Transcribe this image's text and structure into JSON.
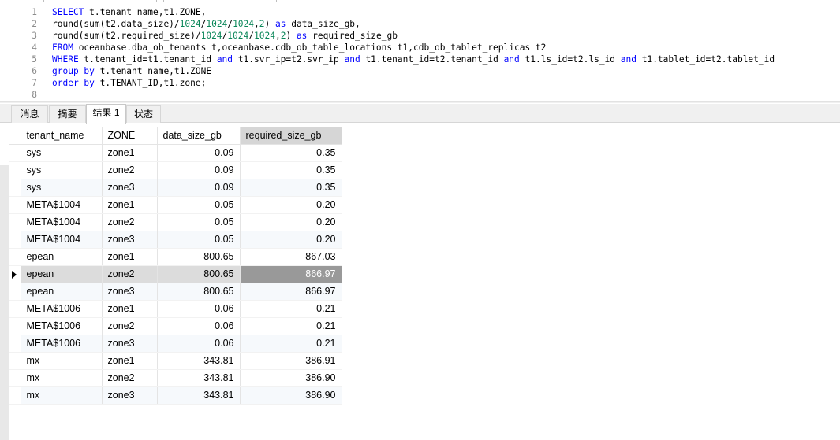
{
  "editor": {
    "lines": [
      {
        "n": "1",
        "parts": [
          [
            "kw",
            "SELECT"
          ],
          [
            "t",
            " t.tenant_name,t1.ZONE,"
          ]
        ]
      },
      {
        "n": "2",
        "parts": [
          [
            "t",
            "round(sum(t2.data_size)/"
          ],
          [
            "num",
            "1024"
          ],
          [
            "t",
            "/"
          ],
          [
            "num",
            "1024"
          ],
          [
            "t",
            "/"
          ],
          [
            "num",
            "1024"
          ],
          [
            "t",
            ","
          ],
          [
            "num",
            "2"
          ],
          [
            "t",
            ") "
          ],
          [
            "kw",
            "as"
          ],
          [
            "t",
            " data_size_gb,"
          ]
        ]
      },
      {
        "n": "3",
        "parts": [
          [
            "t",
            "round(sum(t2.required_size)/"
          ],
          [
            "num",
            "1024"
          ],
          [
            "t",
            "/"
          ],
          [
            "num",
            "1024"
          ],
          [
            "t",
            "/"
          ],
          [
            "num",
            "1024"
          ],
          [
            "t",
            ","
          ],
          [
            "num",
            "2"
          ],
          [
            "t",
            ") "
          ],
          [
            "kw",
            "as"
          ],
          [
            "t",
            " required_size_gb"
          ]
        ]
      },
      {
        "n": "4",
        "parts": [
          [
            "kw",
            "FROM"
          ],
          [
            "t",
            " oceanbase.dba_ob_tenants t,oceanbase.cdb_ob_table_locations t1,cdb_ob_tablet_replicas t2"
          ]
        ]
      },
      {
        "n": "5",
        "parts": [
          [
            "kw",
            "WHERE"
          ],
          [
            "t",
            " t.tenant_id=t1.tenant_id "
          ],
          [
            "kw",
            "and"
          ],
          [
            "t",
            " t1.svr_ip=t2.svr_ip "
          ],
          [
            "kw",
            "and"
          ],
          [
            "t",
            " t1.tenant_id=t2.tenant_id "
          ],
          [
            "kw",
            "and"
          ],
          [
            "t",
            " t1.ls_id=t2.ls_id "
          ],
          [
            "kw",
            "and"
          ],
          [
            "t",
            " t1.tablet_id=t2.tablet_id"
          ]
        ]
      },
      {
        "n": "6",
        "parts": [
          [
            "kw",
            "group by"
          ],
          [
            "t",
            " t.tenant_name,t1.ZONE"
          ]
        ]
      },
      {
        "n": "7",
        "parts": [
          [
            "kw",
            "order by"
          ],
          [
            "t",
            " t.TENANT_ID,t1.zone;"
          ]
        ]
      },
      {
        "n": "8",
        "parts": []
      }
    ]
  },
  "tabs": [
    {
      "label": "消息",
      "active": false
    },
    {
      "label": "摘要",
      "active": false
    },
    {
      "label": "结果 1",
      "active": true
    },
    {
      "label": "状态",
      "active": false
    }
  ],
  "grid": {
    "columns": [
      "tenant_name",
      "ZONE",
      "data_size_gb",
      "required_size_gb"
    ],
    "sorted_column": 3,
    "selected_row": 7,
    "rows": [
      [
        "sys",
        "zone1",
        "0.09",
        "0.35"
      ],
      [
        "sys",
        "zone2",
        "0.09",
        "0.35"
      ],
      [
        "sys",
        "zone3",
        "0.09",
        "0.35"
      ],
      [
        "META$1004",
        "zone1",
        "0.05",
        "0.20"
      ],
      [
        "META$1004",
        "zone2",
        "0.05",
        "0.20"
      ],
      [
        "META$1004",
        "zone3",
        "0.05",
        "0.20"
      ],
      [
        "epean",
        "zone1",
        "800.65",
        "867.03"
      ],
      [
        "epean",
        "zone2",
        "800.65",
        "866.97"
      ],
      [
        "epean",
        "zone3",
        "800.65",
        "866.97"
      ],
      [
        "META$1006",
        "zone1",
        "0.06",
        "0.21"
      ],
      [
        "META$1006",
        "zone2",
        "0.06",
        "0.21"
      ],
      [
        "META$1006",
        "zone3",
        "0.06",
        "0.21"
      ],
      [
        "mx",
        "zone1",
        "343.81",
        "386.91"
      ],
      [
        "mx",
        "zone2",
        "343.81",
        "386.90"
      ],
      [
        "mx",
        "zone3",
        "343.81",
        "386.90"
      ]
    ]
  }
}
